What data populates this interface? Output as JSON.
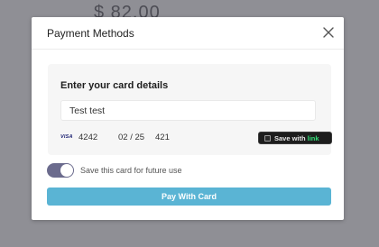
{
  "background": {
    "amount": "$ 82.00"
  },
  "modal": {
    "title": "Payment Methods",
    "close_icon": "close-icon"
  },
  "card_form": {
    "heading": "Enter your card details",
    "cardholder_value": "Test test",
    "brand": "VISA",
    "last4": "4242",
    "expiry": "02 / 25",
    "cvc": "421",
    "link_label": "Save with",
    "link_brand": "link"
  },
  "save_card": {
    "label": "Save this card for future use",
    "enabled": true
  },
  "pay_button": {
    "label": "Pay With Card"
  },
  "colors": {
    "accent": "#5ab4d4",
    "toggle_on": "#6b6b8d",
    "link_green": "#33dd77",
    "overlay": "#8f8f95"
  }
}
